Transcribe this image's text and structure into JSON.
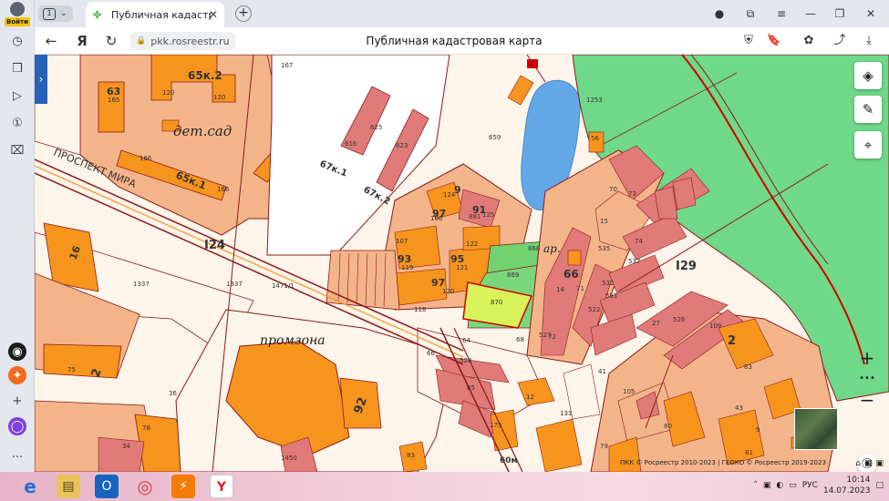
{
  "sidebar": {
    "login_label": "Войти",
    "items": [
      "history-icon",
      "collections-icon",
      "video-icon",
      "tab-number-icon",
      "screenshot-icon"
    ],
    "bottom": [
      "alice-camera-icon",
      "zen-icon",
      "add-icon",
      "alice-icon",
      "more-icon"
    ]
  },
  "tabs": {
    "count": "1",
    "active_title": "Публичная кадастровая",
    "accent": "#4caf50"
  },
  "address": {
    "url": "pkk.rosreestr.ru",
    "page_title": "Публичная кадастровая карта"
  },
  "map": {
    "labels": {
      "det_sad": "дет.сад",
      "promzona": "промзона",
      "prospekt": "ПРОСПЕКТ МИРА",
      "par": "ар.",
      "n124": "I24",
      "n129": "I29",
      "n65k2": "65к.2",
      "n65k1": "65к.1",
      "n67k1": "67к.1",
      "n67k2": "67к.2",
      "n63": "63",
      "n92": "92",
      "n2": "2",
      "n2b": "2",
      "n66": "66",
      "n60m": "60м",
      "b16": "16",
      "b95": "95",
      "b97": "97",
      "b93": "93",
      "b97b": "97",
      "b91": "91",
      "b9": "9"
    },
    "parcels": [
      "167",
      "120",
      "165",
      "120",
      "166",
      "166",
      "616",
      "625",
      "623",
      "659",
      "124",
      "106",
      "881",
      "125",
      "107",
      "122",
      "119",
      "121",
      "120",
      "868",
      "869",
      "870",
      "1337",
      "1337",
      "1471/1",
      "118",
      "64",
      "66",
      "528",
      "65",
      "75",
      "78",
      "34",
      "36",
      "1450",
      "83",
      "175",
      "12",
      "131",
      "68",
      "527",
      "72",
      "70",
      "73",
      "15",
      "535",
      "74",
      "537",
      "532",
      "531",
      "71",
      "522",
      "14",
      "56",
      "1253",
      "27",
      "526",
      "109",
      "83",
      "80",
      "31",
      "9",
      "81",
      "43",
      "41",
      "105",
      "79",
      "120"
    ],
    "copyright": "ПКК © Росреестр 2010-2023 | ГЕОКО © Росреестр 2019-2023",
    "tools": [
      "layers-icon",
      "ruler-icon",
      "locate-icon"
    ],
    "zoom_in": "+",
    "zoom_out": "−"
  },
  "taskbar": {
    "apps": [
      "ie-icon",
      "explorer-icon",
      "outlook-icon",
      "chrome-icon",
      "yandex-icon-1",
      "yandex-browser-icon"
    ],
    "lang": "РУС",
    "time": "10:14",
    "date": "14.07.2023"
  }
}
